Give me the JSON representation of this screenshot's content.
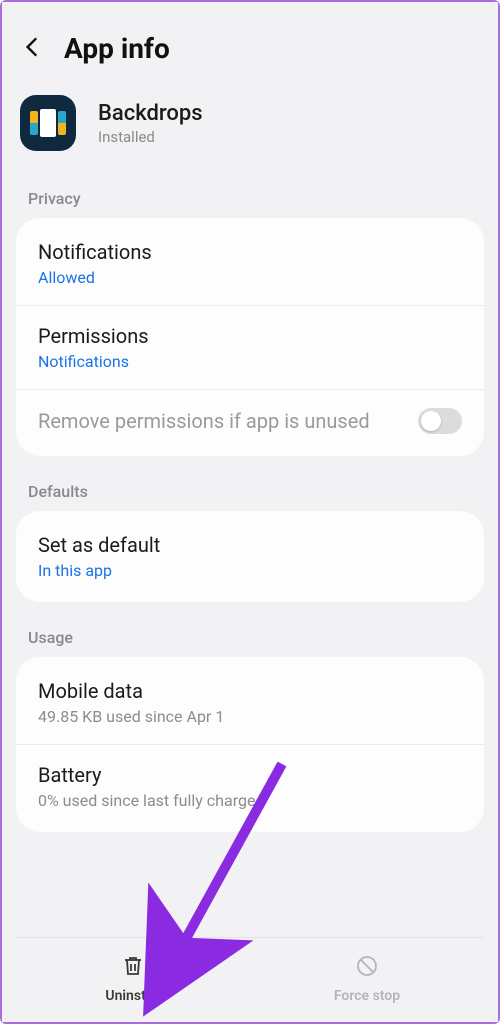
{
  "header": {
    "title": "App info"
  },
  "app": {
    "name": "Backdrops",
    "status": "Installed"
  },
  "sections": {
    "privacy_label": "Privacy",
    "defaults_label": "Defaults",
    "usage_label": "Usage"
  },
  "privacy": {
    "notifications": {
      "title": "Notifications",
      "value": "Allowed"
    },
    "permissions": {
      "title": "Permissions",
      "value": "Notifications"
    },
    "remove_unused": {
      "title": "Remove permissions if app is unused"
    }
  },
  "defaults": {
    "set_default": {
      "title": "Set as default",
      "value": "In this app"
    }
  },
  "usage": {
    "mobile_data": {
      "title": "Mobile data",
      "value": "49.85 KB used since Apr 1"
    },
    "battery": {
      "title": "Battery",
      "value": "0% used since last fully charged"
    }
  },
  "bottom": {
    "uninstall": "Uninstall",
    "force_stop": "Force stop"
  }
}
